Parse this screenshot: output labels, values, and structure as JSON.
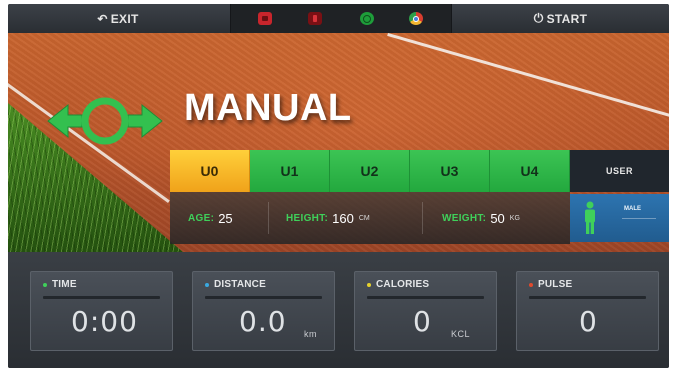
{
  "topbar": {
    "exit_label": "EXIT",
    "start_label": "START",
    "exit_icon": "return-arrow-icon",
    "start_icon": "power-icon",
    "apps": [
      {
        "name": "youtube-icon",
        "color": "#c8252c"
      },
      {
        "name": "app-icon",
        "color": "#7a1014"
      },
      {
        "name": "spotify-icon",
        "color": "#1e9d3a"
      },
      {
        "name": "chrome-icon",
        "color": "#4a7fd8"
      }
    ]
  },
  "hero": {
    "mode_title": "MANUAL",
    "mode_icon": "horizontal-arrows-circle-icon",
    "user_tabs": [
      {
        "label": "U0",
        "active": true
      },
      {
        "label": "U1",
        "active": false
      },
      {
        "label": "U2",
        "active": false
      },
      {
        "label": "U3",
        "active": false
      },
      {
        "label": "U4",
        "active": false
      }
    ],
    "user_label": "USER",
    "profile": {
      "age_label": "AGE:",
      "age_value": "25",
      "height_label": "HEIGHT:",
      "height_value": "160",
      "height_unit": "CM",
      "weight_label": "WEIGHT:",
      "weight_value": "50",
      "weight_unit": "KG"
    },
    "gender": {
      "label": "MALE",
      "icon": "person-icon"
    }
  },
  "stats": [
    {
      "label": "TIME",
      "value": "0:00",
      "unit": "",
      "dot_color": "#3fd05a"
    },
    {
      "label": "DISTANCE",
      "value": "0.0",
      "unit": "km",
      "dot_color": "#3aa9e0"
    },
    {
      "label": "CALORIES",
      "value": "0",
      "unit": "KCL",
      "dot_color": "#e6d12d"
    },
    {
      "label": "PULSE",
      "value": "0",
      "unit": "",
      "dot_color": "#e04a2d"
    }
  ],
  "colors": {
    "accent_green": "#2fb84a",
    "active_tab": "#f5b22a",
    "gender_blue": "#2d74b0",
    "track_orange": "#c15b2c"
  }
}
